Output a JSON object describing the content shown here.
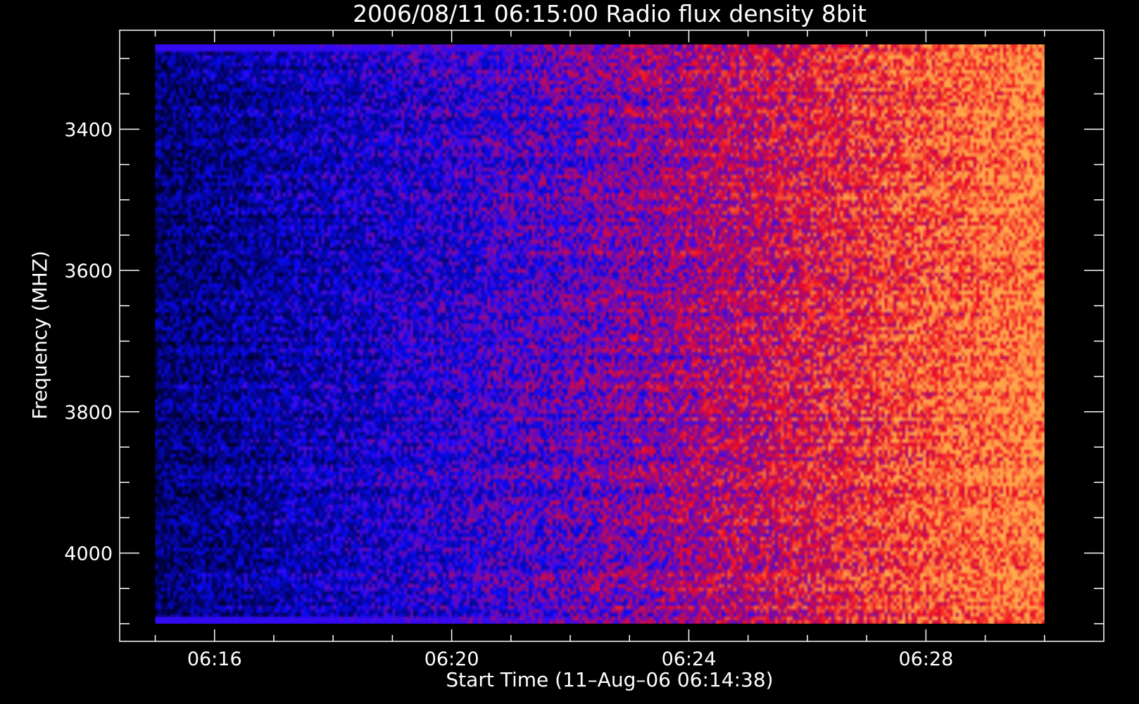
{
  "chart_data": {
    "type": "heatmap",
    "title": "2006/08/11 06:15:00 Radio flux density 8bit",
    "xlabel": "Start Time (11–Aug–06 06:14:38)",
    "ylabel": "Frequency (MHZ)",
    "x_ticks": [
      "06:16",
      "06:20",
      "06:24",
      "06:28"
    ],
    "x_tick_values_min": [
      16,
      20,
      24,
      28
    ],
    "x_range_min": [
      14.4,
      31
    ],
    "x_data_range_min": [
      15,
      30
    ],
    "y_ticks": [
      "3400",
      "3600",
      "3800",
      "4000"
    ],
    "y_tick_values": [
      3400,
      3600,
      3800,
      4000
    ],
    "y_range": [
      3260,
      4125
    ],
    "y_data_range": [
      3280,
      4100
    ],
    "y_inverted": true,
    "colormap": [
      "#000000",
      "#1a10ff",
      "#ff2010",
      "#ffc040"
    ],
    "intensity_trend": {
      "time_min": [
        15,
        18,
        21,
        24,
        26,
        28,
        30
      ],
      "level": [
        0.15,
        0.3,
        0.45,
        0.6,
        0.72,
        0.85,
        0.95
      ]
    },
    "grid": false
  }
}
